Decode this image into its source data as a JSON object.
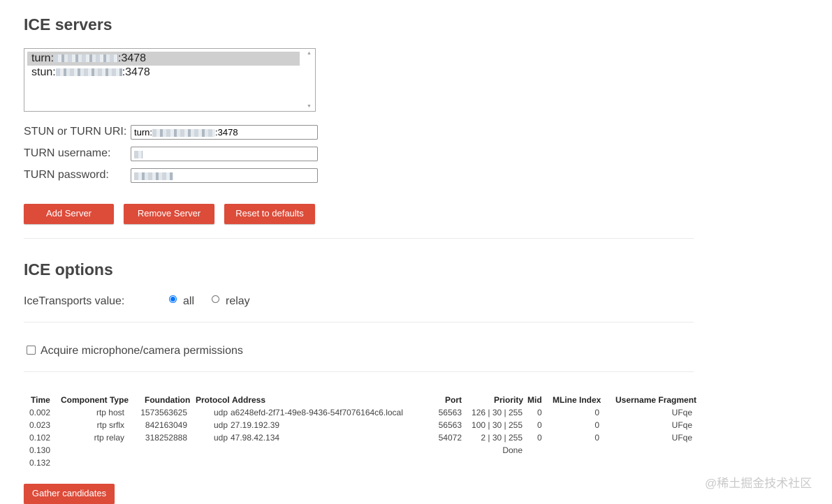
{
  "ice_servers": {
    "title": "ICE servers",
    "list": [
      {
        "label": "turn:",
        "port": ":3478",
        "selected": true
      },
      {
        "label": "stun:",
        "port": ":3478",
        "selected": false
      }
    ],
    "uri_label": "STUN or TURN URI:",
    "uri_prefix": "turn:",
    "uri_suffix": ":3478",
    "username_label": "TURN username:",
    "password_label": "TURN password:",
    "buttons": {
      "add": "Add Server",
      "remove": "Remove Server",
      "reset": "Reset to defaults"
    }
  },
  "ice_options": {
    "title": "ICE options",
    "transports_label": "IceTransports value:",
    "options": [
      {
        "label": "all",
        "checked": true
      },
      {
        "label": "relay",
        "checked": false
      }
    ]
  },
  "permissions": {
    "label": "Acquire microphone/camera permissions",
    "checked": false
  },
  "candidates": {
    "headers": [
      "Time",
      "Component Type",
      "Foundation",
      "Protocol",
      "Address",
      "Port",
      "Priority",
      "Mid",
      "MLine Index",
      "Username Fragment"
    ],
    "rows": [
      {
        "time": "0.002",
        "component_type": "rtp host",
        "foundation": "1573563625",
        "protocol": "udp",
        "address": "a6248efd-2f71-49e8-9436-54f7076164c6.local",
        "port": "56563",
        "priority": "126 | 30 | 255",
        "mid": "0",
        "mline_index": "0",
        "ufrag": "UFqe"
      },
      {
        "time": "0.023",
        "component_type": "rtp srflx",
        "foundation": "842163049",
        "protocol": "udp",
        "address": "27.19.192.39",
        "port": "56563",
        "priority": "100 | 30 | 255",
        "mid": "0",
        "mline_index": "0",
        "ufrag": "UFqe"
      },
      {
        "time": "0.102",
        "component_type": "rtp relay",
        "foundation": "318252888",
        "protocol": "udp",
        "address": "47.98.42.134",
        "port": "54072",
        "priority": "2 | 30 | 255",
        "mid": "0",
        "mline_index": "0",
        "ufrag": "UFqe"
      }
    ],
    "extra_rows": [
      {
        "time": "0.130",
        "note": "Done"
      },
      {
        "time": "0.132",
        "note": ""
      }
    ],
    "gather_button": "Gather candidates"
  },
  "watermark": "@稀土掘金技术社区",
  "colors": {
    "button": "#dd4b39",
    "radio_accent": "#0075ff",
    "heading": "#444444"
  }
}
